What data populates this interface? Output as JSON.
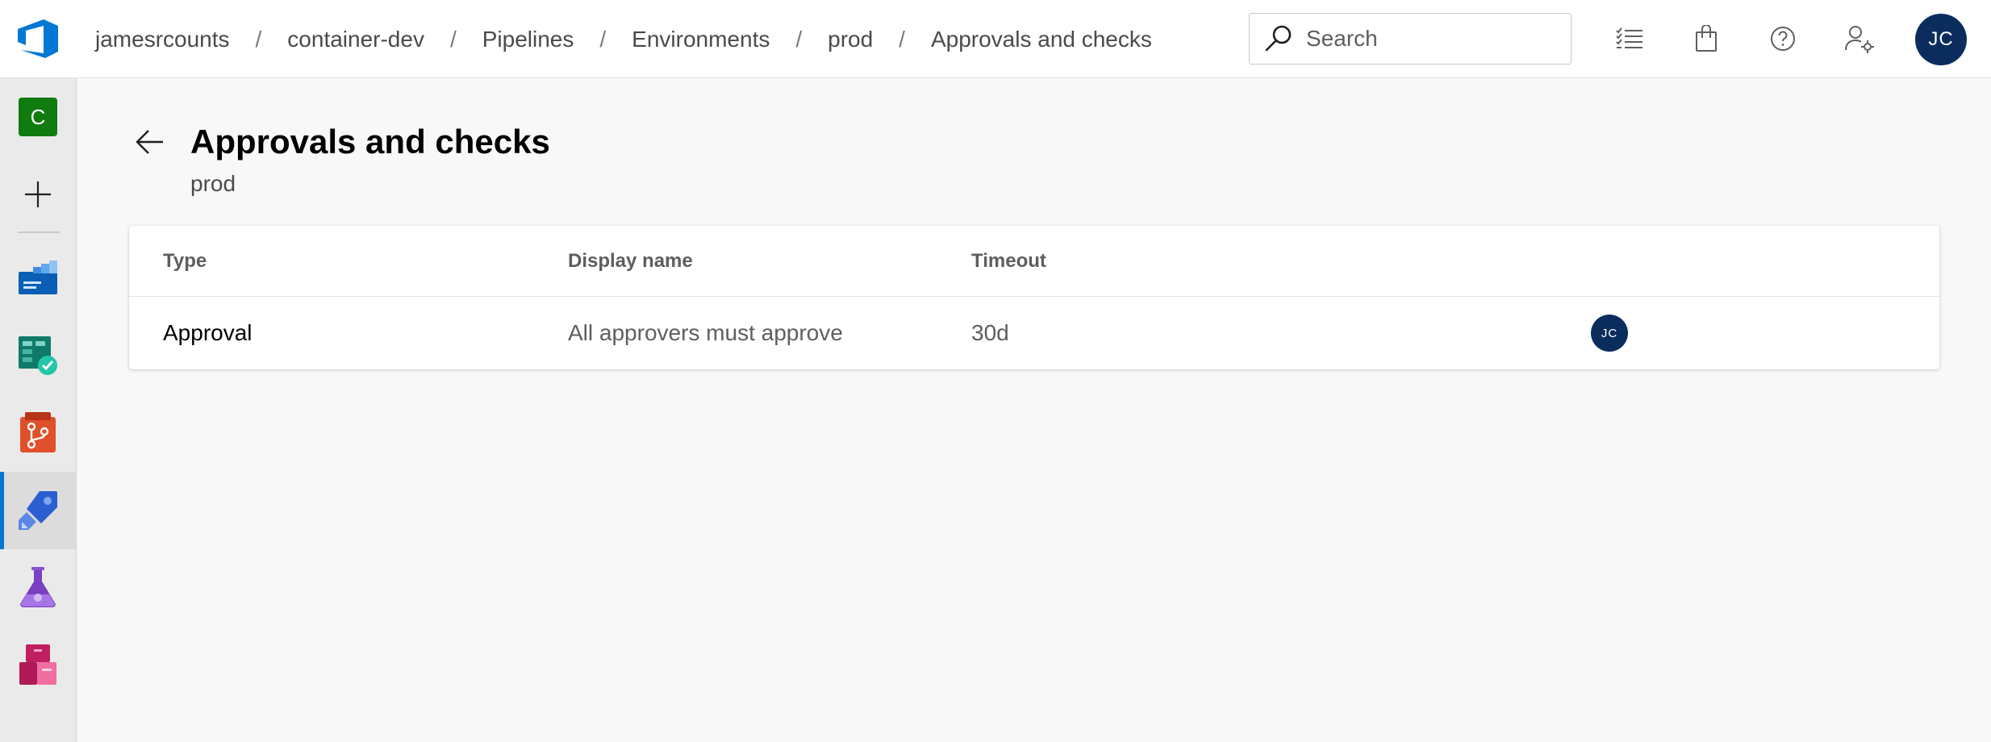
{
  "header": {
    "breadcrumbs": [
      "jamesrcounts",
      "container-dev",
      "Pipelines",
      "Environments",
      "prod",
      "Approvals and checks"
    ],
    "separator": "/",
    "search_placeholder": "Search",
    "user_initials": "JC",
    "icons": [
      "azure-devops-logo-icon",
      "work-items-icon",
      "marketplace-bag-icon",
      "help-icon",
      "user-settings-icon"
    ]
  },
  "sidebar": {
    "project_initial": "C",
    "items": [
      {
        "name": "project",
        "icon": "project-badge-icon"
      },
      {
        "name": "new",
        "icon": "plus-icon"
      },
      {
        "name": "overview",
        "icon": "overview-icon"
      },
      {
        "name": "boards",
        "icon": "boards-icon"
      },
      {
        "name": "repos",
        "icon": "repos-icon"
      },
      {
        "name": "pipelines",
        "icon": "pipelines-icon",
        "active": true
      },
      {
        "name": "test-plans",
        "icon": "test-plans-icon"
      },
      {
        "name": "artifacts",
        "icon": "artifacts-icon"
      }
    ]
  },
  "page": {
    "title": "Approvals and checks",
    "subtitle": "prod"
  },
  "table": {
    "columns": [
      "Type",
      "Display name",
      "Timeout"
    ],
    "rows": [
      {
        "type": "Approval",
        "display_name": "All approvers must approve",
        "timeout": "30d",
        "approver_initials": "JC"
      }
    ]
  },
  "colors": {
    "accent": "#0078d4",
    "avatar": "#0b2d5e",
    "project_badge": "#107c10"
  }
}
